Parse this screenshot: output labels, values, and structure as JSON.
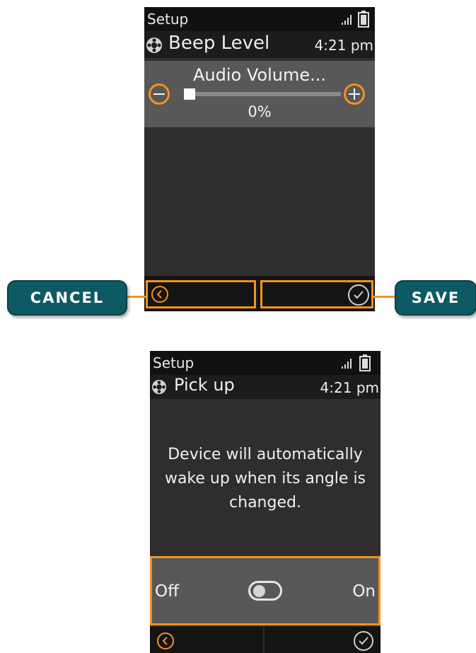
{
  "screen1": {
    "app_name": "Setup",
    "title": "Beep Level",
    "time": "4:21 pm",
    "volume_label": "Audio Volume...",
    "volume_value": "0%",
    "volume_level": 0,
    "cancel_callout": "CANCEL",
    "save_callout": "SAVE"
  },
  "screen2": {
    "app_name": "Setup",
    "title": "Pick up",
    "time": "4:21 pm",
    "description_lines": [
      "Device will automatically",
      "wake up when its angle is",
      "changed."
    ],
    "toggle_off_label": "Off",
    "toggle_on_label": "On",
    "toggle_state": "off"
  },
  "colors": {
    "highlight": "#f5921e",
    "callout_bg": "#0e5a64",
    "screen_bg": "#2e2e2e",
    "panel_bg": "#585858"
  },
  "icons": [
    "signal-icon",
    "battery-icon",
    "gear-icon",
    "minus-icon",
    "plus-icon",
    "back-icon",
    "check-icon"
  ]
}
